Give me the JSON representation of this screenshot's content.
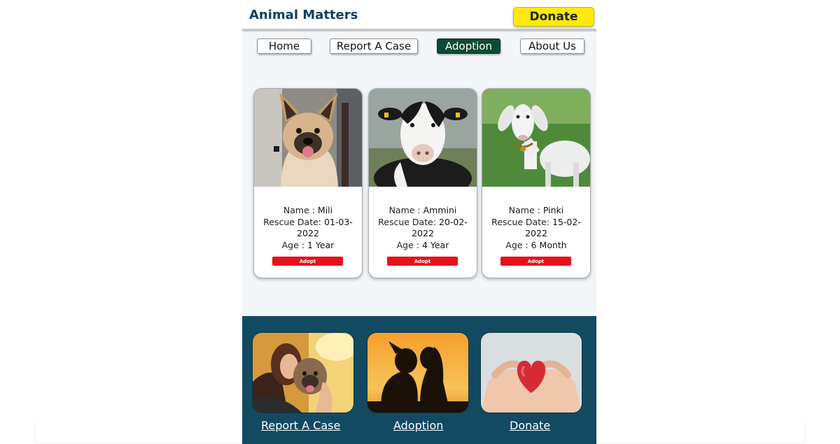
{
  "header": {
    "brand": "Animal Matters",
    "donate_label": "Donate"
  },
  "nav": {
    "items": [
      {
        "label": "Home",
        "active": false
      },
      {
        "label": "Report A Case",
        "active": false
      },
      {
        "label": "Adoption",
        "active": true
      },
      {
        "label": "About Us",
        "active": false
      }
    ]
  },
  "cards": [
    {
      "name_label": "Name :",
      "name": "Mili",
      "date_label": "Rescue Date:",
      "date": "01-03-2022",
      "age_label": "Age :",
      "age": "1 Year",
      "button": "Adopt",
      "photo": "dog"
    },
    {
      "name_label": "Name :",
      "name": "Ammini",
      "date_label": "Rescue Date:",
      "date": "20-02-2022",
      "age_label": "Age :",
      "age": "4 Year",
      "button": "Adopt",
      "photo": "cow"
    },
    {
      "name_label": "Name :",
      "name": "Pinki",
      "date_label": "Rescue Date:",
      "date": "15-02-2022",
      "age_label": "Age :",
      "age": "6 Month",
      "button": "Adopt",
      "photo": "goat"
    }
  ],
  "footer": {
    "links": [
      {
        "label": "Report A Case",
        "photo": "woman-hugging-dog"
      },
      {
        "label": "Adoption",
        "photo": "silhouette-girl-and-dog"
      },
      {
        "label": "Donate",
        "photo": "hands-holding-heart"
      }
    ]
  },
  "colors": {
    "brand": "#123f5c",
    "donate": "#ffe90a",
    "nav_active": "#0f4a34",
    "adopt": "#e8101c",
    "footer": "#124a62"
  }
}
